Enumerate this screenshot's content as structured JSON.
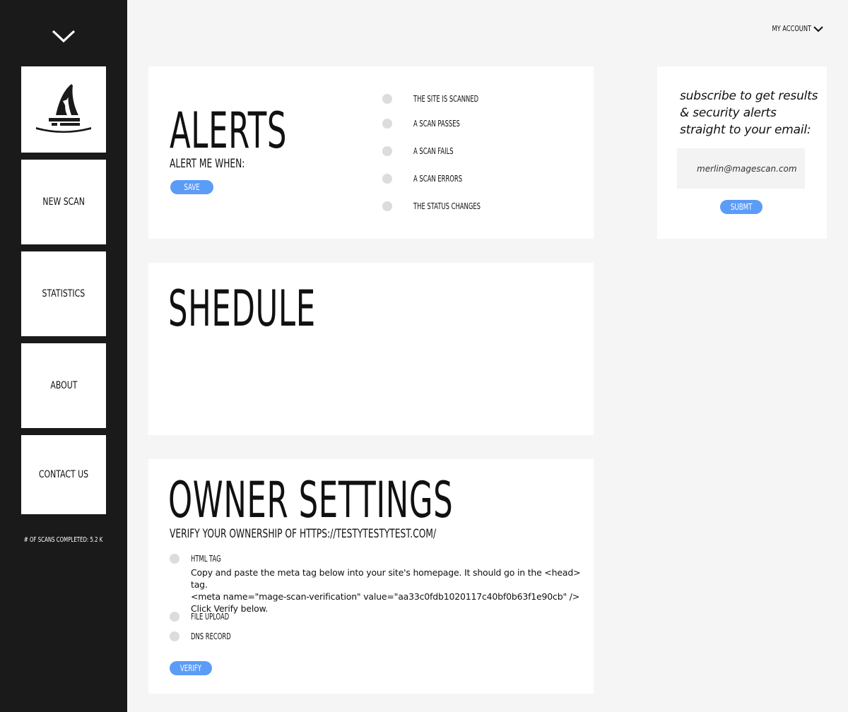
{
  "sidebar": {
    "collapse_icon": "chevron-down-icon",
    "logo_icon": "wizard-hat-icon",
    "nav": [
      {
        "label": "NEW SCAN"
      },
      {
        "label": "STATISTICS"
      },
      {
        "label": "ABOUT"
      },
      {
        "label": "CONTACT US"
      }
    ],
    "scans_completed": "# OF SCANS COMPLETED: 5.2 K"
  },
  "header": {
    "account_label": "MY ACCOUNT",
    "account_icon": "chevron-down-icon"
  },
  "alerts": {
    "title": "ALERTS",
    "subtitle": "ALERT ME WHEN:",
    "save_label": "SAVE",
    "options": [
      {
        "label": "THE SITE IS SCANNED"
      },
      {
        "label": "A SCAN PASSES"
      },
      {
        "label": "A SCAN FAILS"
      },
      {
        "label": "A SCAN ERRORS"
      },
      {
        "label": "THE STATUS CHANGES"
      }
    ]
  },
  "schedule": {
    "title": "SHEDULE"
  },
  "owner": {
    "title": "OWNER SETTINGS",
    "subtitle": "VERIFY YOUR OWNERSHIP OF HTTPS://TESTYTESTYTEST.COM/",
    "options": [
      {
        "label": "HTML TAG"
      },
      {
        "label": "FILE UPLOAD"
      },
      {
        "label": "DNS RECORD"
      }
    ],
    "html_tag_instructions": [
      "Copy and paste the meta tag below into your site's homepage. It should go in the <head> tag.",
      "<meta name=\"mage-scan-verification\" value=\"aa33c0fdb1020117c40bf0b63f1e90cb\" />",
      "Click Verify below."
    ],
    "verify_label": "VERIFY"
  },
  "subscribe": {
    "text": "subscribe to get results & security alerts straight to your email:",
    "email_value": "merlin@magescan.com",
    "submit_label": "SUBMT"
  },
  "colors": {
    "sidebar_bg": "#1a1a1a",
    "accent": "#5b9cf7",
    "page_bg": "#f5f5f5",
    "radio": "#dcdcdc"
  }
}
